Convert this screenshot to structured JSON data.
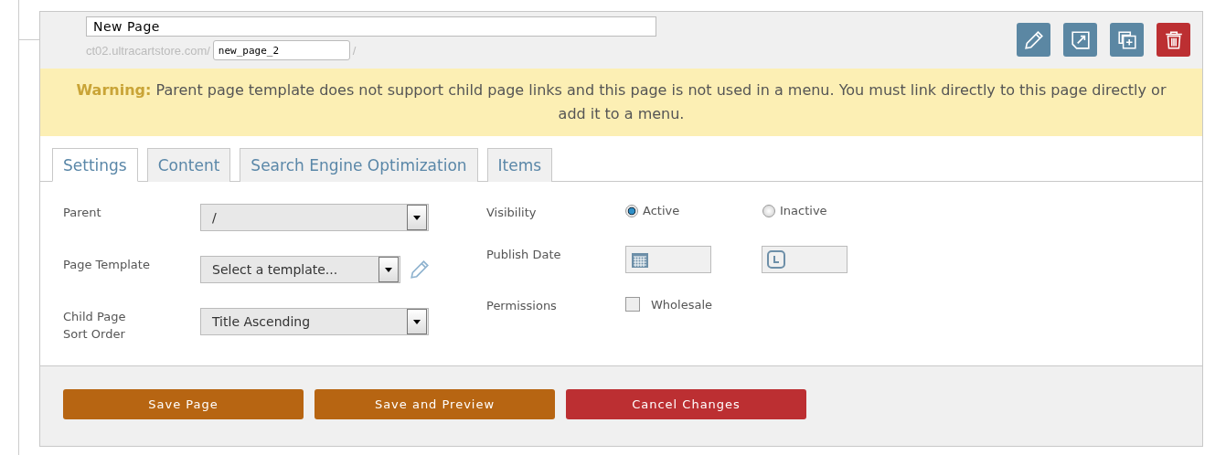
{
  "header": {
    "title": "New Page",
    "url_prefix": "ct02.ultracartstore.com/",
    "slug": "new_page_2",
    "url_suffix": "/"
  },
  "actions": [
    {
      "kind": "edit"
    },
    {
      "kind": "open"
    },
    {
      "kind": "copy"
    },
    {
      "kind": "delete"
    }
  ],
  "warning": {
    "label": "Warning:",
    "text": "Parent page template does not support child page links and this page is not used in a menu. You must link directly to this page directly or add it to a menu."
  },
  "tabs": [
    {
      "label": "Settings",
      "selected": true
    },
    {
      "label": "Content",
      "selected": false
    },
    {
      "label": "Search Engine Optimization",
      "selected": false
    },
    {
      "label": "Items",
      "selected": false
    }
  ],
  "left_fields": [
    {
      "label": "Parent",
      "value": "/",
      "editable": false
    },
    {
      "label": "Page Template",
      "value": "Select a template...",
      "editable": true
    },
    {
      "label": "Child Page\nSort Order",
      "value": "Title Ascending",
      "editable": false
    }
  ],
  "visibility": {
    "label": "Visibility",
    "options": [
      {
        "label": "Active",
        "selected": true
      },
      {
        "label": "Inactive",
        "selected": false
      }
    ]
  },
  "publish_date": {
    "label": "Publish Date"
  },
  "permissions": {
    "label": "Permissions",
    "options": [
      {
        "label": "Wholesale",
        "checked": false
      }
    ]
  },
  "buttons": [
    {
      "label": "Save Page",
      "kind": "primary"
    },
    {
      "label": "Save and Preview",
      "kind": "primary"
    },
    {
      "label": "Cancel Changes",
      "kind": "danger"
    }
  ]
}
